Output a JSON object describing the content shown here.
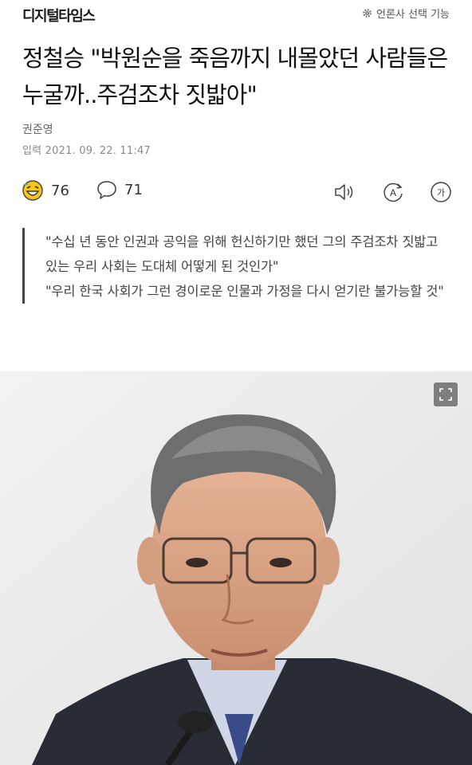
{
  "header": {
    "logo": "디지털타임스",
    "select_label": "언론사 선택 기능",
    "select_icon": "gear-icon"
  },
  "article": {
    "title": "정철승 \"박원순을 죽음까지 내몰았던 사람들은 누굴까..주검조차 짓밟아\"",
    "author": "권준영",
    "date_label": "입력",
    "date_value": "2021. 09. 22. 11:47"
  },
  "reactions": {
    "emoji_count": "76",
    "comment_count": "71",
    "translate_label": "A",
    "fontsize_label": "가"
  },
  "quote": {
    "lines": [
      "\"수십 년 동안 인권과 공익을 위해 헌신하기만 했던 그의 주검조차 짓밟고 있는 우리 사회는 도대체 어떻게 된 것인가\"",
      "\"우리 한국 사회가 그런 경이로운 인물과 가정을 다시 얻기란 불가능할 것\""
    ]
  },
  "photo": {
    "expand_icon": "expand-icon"
  }
}
